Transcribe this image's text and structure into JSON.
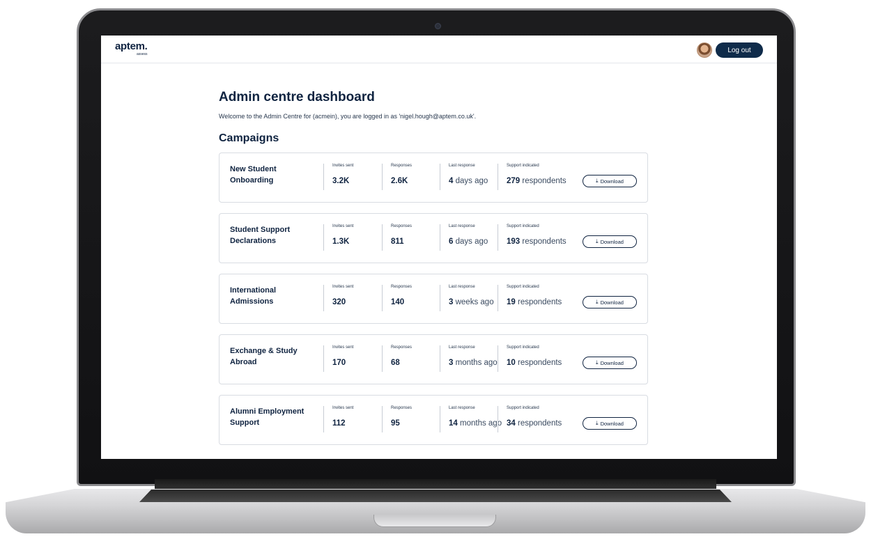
{
  "header": {
    "logo_text": "aptem.",
    "logo_subtext": "assess",
    "logout_label": "Log out"
  },
  "page": {
    "title": "Admin centre dashboard",
    "welcome": "Welcome to the Admin Centre for (acmein), you are logged in as 'nigel.hough@aptem.co.uk'.",
    "section_title": "Campaigns"
  },
  "labels": {
    "invites": "Invites sent",
    "responses": "Responses",
    "last_response": "Last response",
    "support": "Support indicated",
    "download": "Download"
  },
  "campaigns": [
    {
      "name": "New Student Onboarding",
      "invites": "3.2K",
      "responses": "2.6K",
      "last_num": "4",
      "last_unit": "days ago",
      "support_num": "279",
      "support_unit": "respondents"
    },
    {
      "name": "Student Support Declarations",
      "invites": "1.3K",
      "responses": "811",
      "last_num": "6",
      "last_unit": "days ago",
      "support_num": "193",
      "support_unit": "respondents"
    },
    {
      "name": "International Admissions",
      "invites": "320",
      "responses": "140",
      "last_num": "3",
      "last_unit": "weeks ago",
      "support_num": "19",
      "support_unit": "respondents"
    },
    {
      "name": "Exchange & Study Abroad",
      "invites": "170",
      "responses": "68",
      "last_num": "3",
      "last_unit": "months ago",
      "support_num": "10",
      "support_unit": "respondents"
    },
    {
      "name": "Alumni Employment Support",
      "invites": "112",
      "responses": "95",
      "last_num": "14",
      "last_unit": "months ago",
      "support_num": "34",
      "support_unit": "respondents"
    }
  ]
}
